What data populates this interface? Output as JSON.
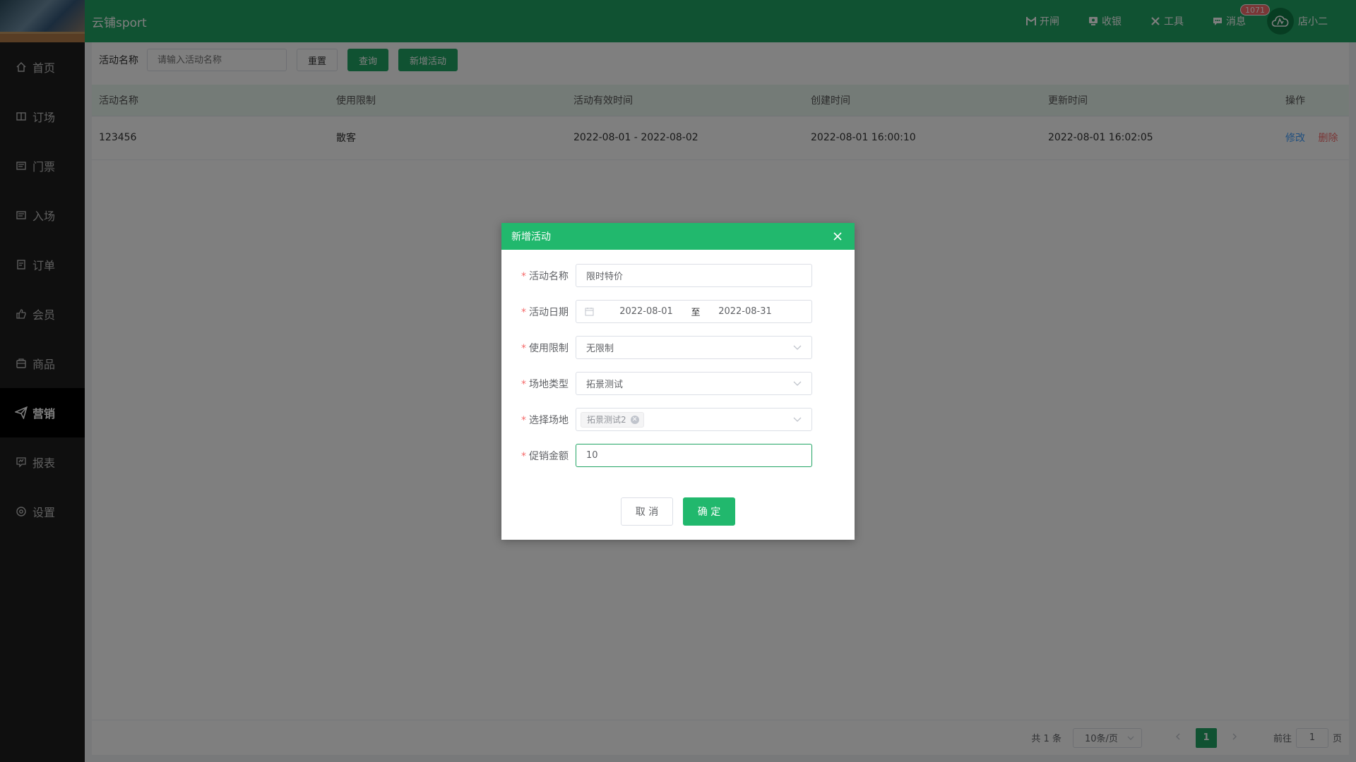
{
  "app": {
    "brand": "云铺sport"
  },
  "header": {
    "tools": [
      {
        "label": "开闸",
        "icon": "gate-icon"
      },
      {
        "label": "收银",
        "icon": "cashier-icon"
      },
      {
        "label": "工具",
        "icon": "tools-icon"
      },
      {
        "label": "消息",
        "icon": "message-icon"
      }
    ],
    "message_badge": "1071",
    "user_name": "店小二"
  },
  "sidebar": {
    "items": [
      {
        "label": "首页",
        "icon": "home-icon"
      },
      {
        "label": "订场",
        "icon": "booking-icon"
      },
      {
        "label": "门票",
        "icon": "ticket-icon"
      },
      {
        "label": "入场",
        "icon": "entry-icon"
      },
      {
        "label": "订单",
        "icon": "order-icon"
      },
      {
        "label": "会员",
        "icon": "member-icon"
      },
      {
        "label": "商品",
        "icon": "goods-icon"
      },
      {
        "label": "营销",
        "icon": "marketing-icon",
        "active": true
      },
      {
        "label": "报表",
        "icon": "report-icon"
      },
      {
        "label": "设置",
        "icon": "settings-icon"
      }
    ]
  },
  "search": {
    "label": "活动名称",
    "placeholder": "请输入活动名称",
    "reset_label": "重置",
    "query_label": "查询",
    "add_label": "新增活动"
  },
  "table": {
    "columns": [
      "活动名称",
      "使用限制",
      "活动有效时间",
      "创建时间",
      "更新时间",
      "操作"
    ],
    "rows": [
      {
        "name": "123456",
        "limit": "散客",
        "valid": "2022-08-01 - 2022-08-02",
        "created": "2022-08-01 16:00:10",
        "updated": "2022-08-01 16:02:05",
        "edit": "修改",
        "delete": "删除"
      }
    ]
  },
  "pagination": {
    "total": "共 1 条",
    "page_size": "10条/页",
    "current_page": "1",
    "goto_prefix": "前往",
    "goto_value": "1",
    "goto_suffix": "页"
  },
  "dialog": {
    "title": "新增活动",
    "fields": {
      "name": {
        "label": "活动名称",
        "value": "限时特价"
      },
      "date": {
        "label": "活动日期",
        "start": "2022-08-01",
        "separator": "至",
        "end": "2022-08-31"
      },
      "limit": {
        "label": "使用限制",
        "value": "无限制"
      },
      "venue_type": {
        "label": "场地类型",
        "value": "拓景测试"
      },
      "venue": {
        "label": "选择场地",
        "tag": "拓景测试2"
      },
      "amount": {
        "label": "促销金额",
        "value": "10"
      }
    },
    "cancel_label": "取 消",
    "confirm_label": "确 定"
  },
  "colors": {
    "primary": "#21a464",
    "dialog_header": "#21b86d",
    "danger": "#f56c6c",
    "link": "#409eff"
  }
}
